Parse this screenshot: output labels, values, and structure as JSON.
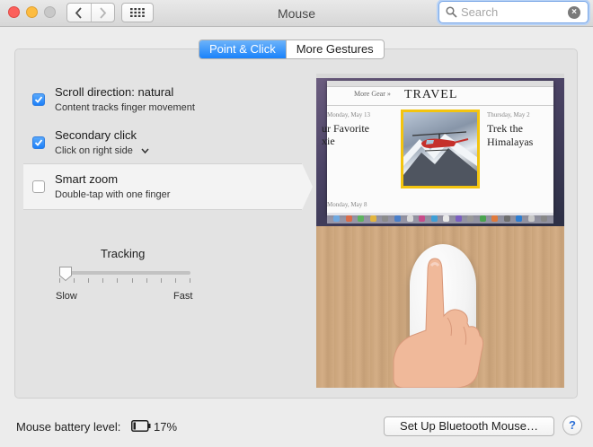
{
  "window": {
    "title": "Mouse",
    "search_placeholder": "Search"
  },
  "toolbar": {
    "back_icon": "chevron-left-icon",
    "forward_icon": "chevron-right-icon",
    "show_all_icon": "grid-icon"
  },
  "tabs": [
    {
      "label": "Point & Click",
      "active": true
    },
    {
      "label": "More Gestures",
      "active": false
    }
  ],
  "options": [
    {
      "title": "Scroll direction: natural",
      "subtitle": "Content tracks finger movement",
      "checked": true
    },
    {
      "title": "Secondary click",
      "subtitle": "Click on right side",
      "checked": true
    },
    {
      "title": "Smart zoom",
      "subtitle": "Double-tap with one finger",
      "checked": false
    }
  ],
  "tracking": {
    "label": "Tracking",
    "min_label": "Slow",
    "max_label": "Fast",
    "value_fraction": 0.05,
    "tick_count": 10
  },
  "preview": {
    "more_link": "More Gear »",
    "section": "TRAVEL",
    "date_left": "Monday, May 13",
    "headline_left": "ur Favorite xie",
    "date_right": "Thursday, May 2",
    "headline_right": "Trek the Himalayas",
    "date_bottom": "Monday, May 8"
  },
  "footer": {
    "battery_label": "Mouse battery level:",
    "battery_percent": "17%",
    "battery_level": 0.17,
    "setup_button": "Set Up Bluetooth Mouse…",
    "help": "?"
  },
  "colors": {
    "accent": "#1a82fb",
    "close": "#fc605c",
    "minimize": "#fdbc40",
    "zoom_disabled": "#c8c8c8",
    "highlight_frame": "#f3c40f"
  }
}
